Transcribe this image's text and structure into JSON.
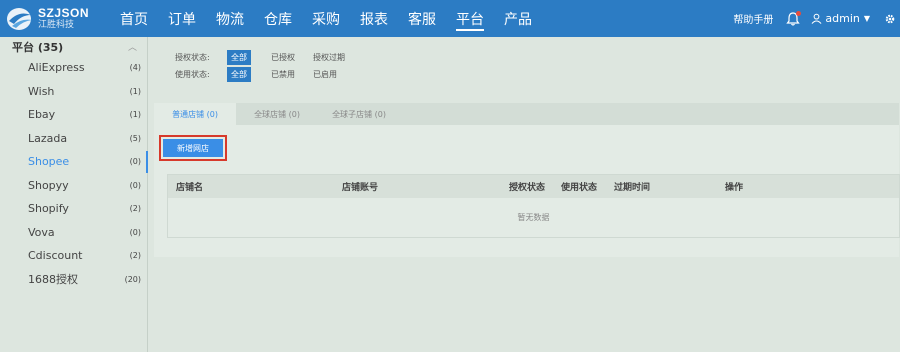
{
  "brand": {
    "name_en": "SZJSON",
    "name_cn": "江胜科技"
  },
  "nav": [
    {
      "label": "首页"
    },
    {
      "label": "订单"
    },
    {
      "label": "物流"
    },
    {
      "label": "仓库"
    },
    {
      "label": "采购"
    },
    {
      "label": "报表"
    },
    {
      "label": "客服"
    },
    {
      "label": "平台"
    },
    {
      "label": "产品"
    }
  ],
  "nav_active_index": 7,
  "header": {
    "help": "帮助手册",
    "user": "admin"
  },
  "sidebar": {
    "title": "平台 (35)",
    "items": [
      {
        "label": "AliExpress",
        "count": "(4)"
      },
      {
        "label": "Wish",
        "count": "(1)"
      },
      {
        "label": "Ebay",
        "count": "(1)"
      },
      {
        "label": "Lazada",
        "count": "(5)"
      },
      {
        "label": "Shopee",
        "count": "(0)"
      },
      {
        "label": "Shopyy",
        "count": "(0)"
      },
      {
        "label": "Shopify",
        "count": "(2)"
      },
      {
        "label": "Vova",
        "count": "(0)"
      },
      {
        "label": "Cdiscount",
        "count": "(2)"
      },
      {
        "label": "1688授权",
        "count": "(20)"
      }
    ],
    "active_index": 4
  },
  "filters": {
    "auth": {
      "label": "授权状态:",
      "options": [
        "全部",
        "已授权",
        "授权过期"
      ]
    },
    "usage": {
      "label": "使用状态:",
      "options": [
        "全部",
        "已禁用",
        "已启用"
      ]
    }
  },
  "tabs": [
    {
      "label": "普通店铺 (0)"
    },
    {
      "label": "全球店铺 (0)"
    },
    {
      "label": "全球子店铺 (0)"
    }
  ],
  "add_button": "新增网店",
  "table": {
    "columns": [
      "店铺名",
      "店铺账号",
      "授权状态",
      "使用状态",
      "过期时间",
      "操作"
    ],
    "empty_text": "暂无数据"
  },
  "colors": {
    "topbar": "#2c7cc4",
    "accent": "#3a8ee6",
    "highlight_border": "#d7392b"
  }
}
